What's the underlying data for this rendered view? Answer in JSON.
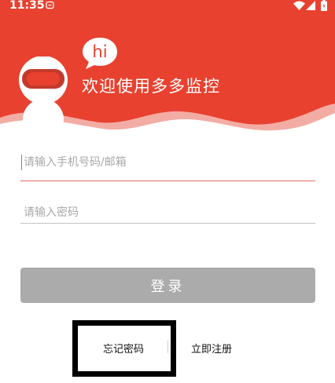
{
  "status_bar": {
    "time": "11:35",
    "icons": [
      "sync-icon",
      "wifi-icon",
      "signal-icon",
      "battery-icon"
    ]
  },
  "header": {
    "bubble_text": "hi",
    "welcome_text": "欢迎使用多多监控",
    "background_color": "#e8412f"
  },
  "form": {
    "phone_placeholder": "请输入手机号码/邮箱",
    "phone_value": "",
    "password_placeholder": "请输入密码",
    "password_value": ""
  },
  "login_button": {
    "label": "登录",
    "color": "#ababab"
  },
  "links": {
    "forgot_password": "忘记密码",
    "register": "立即注册"
  }
}
